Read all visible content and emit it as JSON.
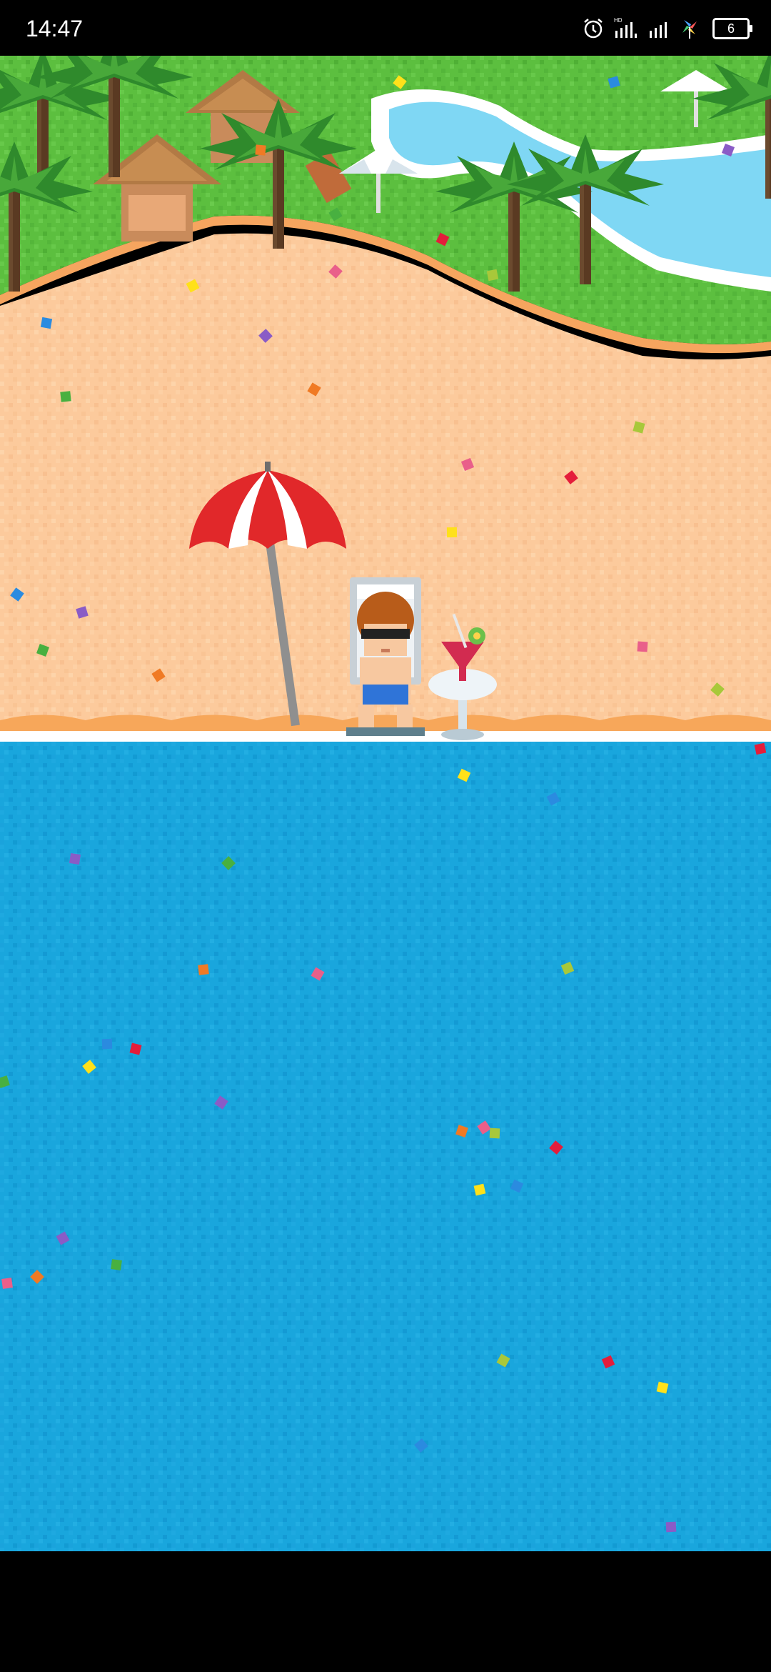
{
  "status_bar": {
    "time": "14:47",
    "icons": [
      "alarm-icon",
      "hd-signal-icon",
      "signal-icon",
      "pinwheel-icon"
    ],
    "battery_level": "6",
    "hd_label": "HD"
  },
  "scene": {
    "type": "pixel-art beach scene",
    "elements": [
      "palm-trees",
      "thatched-huts",
      "swimming-pool",
      "parasol",
      "beach-umbrella",
      "player-character-on-lounger",
      "cocktail-table",
      "ocean",
      "confetti"
    ],
    "colors": {
      "grass": "#5cbf3f",
      "sand": "#fcc99a",
      "ocean": "#19a6dd",
      "pool": "#7fd7f4",
      "umbrella_red": "#e1282a",
      "umbrella_white": "#ffffff"
    }
  }
}
